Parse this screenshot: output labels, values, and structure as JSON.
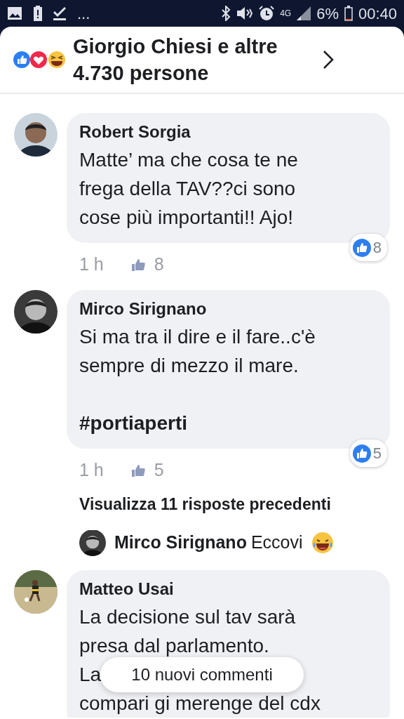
{
  "status_bar": {
    "overflow": "...",
    "network": "4G",
    "battery_percent": "6%",
    "time": "00:40"
  },
  "reactions_header": {
    "title": "Giorgio Chiesi e altre 4.730 persone"
  },
  "comments": [
    {
      "author": "Robert Sorgia",
      "lines": [
        "Matte’ ma che cosa te ne",
        "frega della TAV??ci sono",
        "cose più importanti!! Ajo!"
      ],
      "time": "1 h",
      "like_count": "8",
      "reaction_count": "8"
    },
    {
      "author": "Mirco Sirignano",
      "lines": [
        "Si ma tra il dire e il fare..c'è",
        "sempre di mezzo il mare."
      ],
      "hashtag": "#portiaperti",
      "time": "1 h",
      "like_count": "5",
      "reaction_count": "5",
      "replies": {
        "more_label": "Visualizza 11 risposte precedenti",
        "latest": {
          "author": "Mirco Sirignano",
          "text": "Eccovi"
        }
      }
    },
    {
      "author": "Matteo Usai",
      "lines": [
        "La decisione sul tav sarà",
        "presa dal parlamento.",
        "La",
        "compari gi merenge del cdx"
      ]
    }
  ],
  "toast": {
    "label": "10 nuovi commenti"
  }
}
